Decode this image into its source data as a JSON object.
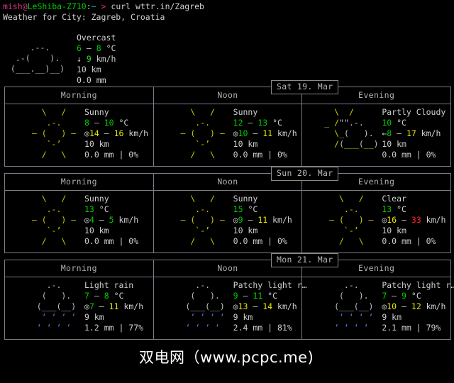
{
  "terminal": {
    "prompt": {
      "user_host": "mish@LeShiba-Z710",
      "user": "mish@",
      "host": "LeShiba-Z710",
      "colon": ":",
      "path": "~",
      "symbol": ">",
      "command": "curl wttr.in/Zagreb"
    },
    "subtitle": "Weather for City: Zagreb, Croatia"
  },
  "current": {
    "art": [
      "     .--.    ",
      "  .-(    ).  ",
      " (___.__)__) "
    ],
    "condition": "Overcast",
    "temperature": "6 – 8 °C",
    "temp_low": "6",
    "temp_dash": " – ",
    "temp_high": "8",
    "temp_unit": " °C",
    "wind_icon": "↓",
    "wind_value": "9",
    "wind_unit": " km/h",
    "visibility": "10 km",
    "precipitation": "0.0 mm"
  },
  "columns": [
    "Morning",
    "Noon",
    "Evening"
  ],
  "days": [
    {
      "label": "Sat 19. Mar",
      "slots": [
        {
          "period": "Morning",
          "icon": "sun",
          "art": [
            "    \\   /    ",
            "     .-.     ",
            "  ― (   ) ―  ",
            "     `-’     ",
            "    /   \\    "
          ],
          "condition": "Sunny",
          "temp_low": "8",
          "temp_dash": " – ",
          "temp_high": "10",
          "temp_unit": " °C",
          "temp_low_color": "green",
          "temp_high_color": "green",
          "wind_icon": "◎",
          "wind_low": "14",
          "wind_dash": " – ",
          "wind_high": "16",
          "wind_unit": " km/h",
          "wind_low_color": "yellow",
          "wind_high_color": "yellow",
          "visibility": "10 km",
          "precip": "0.0 mm | 0%"
        },
        {
          "period": "Noon",
          "icon": "sun",
          "art": [
            "    \\   /    ",
            "     .-.     ",
            "  ― (   ) ―  ",
            "     `-’     ",
            "    /   \\    "
          ],
          "condition": "Sunny",
          "temp_low": "12",
          "temp_dash": " – ",
          "temp_high": "13",
          "temp_unit": " °C",
          "temp_low_color": "green",
          "temp_high_color": "green",
          "wind_icon": "◎",
          "wind_low": "10",
          "wind_dash": " – ",
          "wind_high": "11",
          "wind_unit": " km/h",
          "wind_low_color": "green",
          "wind_high_color": "yellow",
          "visibility": "10 km",
          "precip": "0.0 mm | 0%"
        },
        {
          "period": "Evening",
          "icon": "partly-cloudy",
          "art": [
            "   \\  /      ",
            " _ /\"\".-.    ",
            "   \\_(   ).  ",
            "   /(___(__) ",
            "             "
          ],
          "condition": "Partly Cloudy",
          "temp_low": "10",
          "temp_dash": "",
          "temp_high": "",
          "temp_unit": " °C",
          "temp_low_color": "green",
          "temp_high_color": "green",
          "wind_icon": "←",
          "wind_low": "8",
          "wind_dash": " – ",
          "wind_high": "17",
          "wind_unit": " km/h",
          "wind_low_color": "green",
          "wind_high_color": "yellow",
          "visibility": "10 km",
          "precip": "0.0 mm | 0%"
        }
      ]
    },
    {
      "label": "Sun 20. Mar",
      "slots": [
        {
          "period": "Morning",
          "icon": "sun",
          "art": [
            "    \\   /    ",
            "     .-.     ",
            "  ― (   ) ―  ",
            "     `-’     ",
            "    /   \\    "
          ],
          "condition": "Sunny",
          "temp_low": "13",
          "temp_dash": "",
          "temp_high": "",
          "temp_unit": " °C",
          "temp_low_color": "green",
          "temp_high_color": "green",
          "wind_icon": "◎",
          "wind_low": "4",
          "wind_dash": " – ",
          "wind_high": "5",
          "wind_unit": " km/h",
          "wind_low_color": "green",
          "wind_high_color": "green",
          "visibility": "10 km",
          "precip": "0.0 mm | 0%"
        },
        {
          "period": "Noon",
          "icon": "sun",
          "art": [
            "    \\   /    ",
            "     .-.     ",
            "  ― (   ) ―  ",
            "     `-’     ",
            "    /   \\    "
          ],
          "condition": "Sunny",
          "temp_low": "15",
          "temp_dash": "",
          "temp_high": "",
          "temp_unit": " °C",
          "temp_low_color": "green",
          "temp_high_color": "green",
          "wind_icon": "◎",
          "wind_low": "9",
          "wind_dash": " – ",
          "wind_high": "11",
          "wind_unit": " km/h",
          "wind_low_color": "green",
          "wind_high_color": "yellow",
          "visibility": "10 km",
          "precip": "0.0 mm | 0%"
        },
        {
          "period": "Evening",
          "icon": "sun",
          "art": [
            "    \\   /    ",
            "     .-.     ",
            "  ― (   ) ―  ",
            "     `-’     ",
            "    /   \\    "
          ],
          "condition": "Clear",
          "temp_low": "13",
          "temp_dash": "",
          "temp_high": "",
          "temp_unit": " °C",
          "temp_low_color": "green",
          "temp_high_color": "green",
          "wind_icon": "◎",
          "wind_low": "16",
          "wind_dash": " – ",
          "wind_high": "33",
          "wind_unit": " km/h",
          "wind_low_color": "yellow",
          "wind_high_color": "red",
          "visibility": "10 km",
          "precip": "0.0 mm | 0%"
        }
      ]
    },
    {
      "label": "Mon 21. Mar",
      "slots": [
        {
          "period": "Morning",
          "icon": "light-rain",
          "art": [
            "     .-.     ",
            "    (   ).   ",
            "   (___(__)  ",
            "    ‘ ‘ ‘ ‘  ",
            "   ‘ ‘ ‘ ‘   "
          ],
          "condition": "Light rain",
          "temp_low": "7",
          "temp_dash": " – ",
          "temp_high": "8",
          "temp_unit": " °C",
          "temp_low_color": "green",
          "temp_high_color": "green",
          "wind_icon": "◎",
          "wind_low": "7",
          "wind_dash": " – ",
          "wind_high": "11",
          "wind_unit": " km/h",
          "wind_low_color": "green",
          "wind_high_color": "yellow",
          "visibility": "9 km",
          "precip": "1.2 mm | 77%"
        },
        {
          "period": "Noon",
          "icon": "light-rain",
          "art": [
            "     .-.     ",
            "    (   ).   ",
            "   (___(__)  ",
            "    ‘ ‘ ‘ ‘  ",
            "   ‘ ‘ ‘ ‘   "
          ],
          "condition": "Patchy light r…",
          "temp_low": "9",
          "temp_dash": " – ",
          "temp_high": "11",
          "temp_unit": " °C",
          "temp_low_color": "green",
          "temp_high_color": "green",
          "wind_icon": "◎",
          "wind_low": "13",
          "wind_dash": " – ",
          "wind_high": "14",
          "wind_unit": " km/h",
          "wind_low_color": "yellow",
          "wind_high_color": "yellow",
          "visibility": "9 km",
          "precip": "2.4 mm | 81%"
        },
        {
          "period": "Evening",
          "icon": "light-rain",
          "art": [
            "     .-.     ",
            "    (   ).   ",
            "   (___(__)  ",
            "    ‘ ‘ ‘ ‘  ",
            "   ‘ ‘ ‘ ‘   "
          ],
          "condition": "Patchy light r…",
          "temp_low": "7",
          "temp_dash": " – ",
          "temp_high": "9",
          "temp_unit": " °C",
          "temp_low_color": "green",
          "temp_high_color": "green",
          "wind_icon": "◎",
          "wind_low": "10",
          "wind_dash": " – ",
          "wind_high": "12",
          "wind_unit": " km/h",
          "wind_low_color": "yellow",
          "wind_high_color": "yellow",
          "visibility": "9 km",
          "precip": "2.1 mm | 79%"
        }
      ]
    }
  ],
  "watermark": "双电网（www.pcpc.me)",
  "colors": {
    "background": "#000000",
    "foreground": "#c8c8c8",
    "green": "#00cc00",
    "yellow": "#cdcd00",
    "red": "#cd0000",
    "magenta": "#d33682",
    "cyan": "#00cdcd",
    "border": "#7c7c88"
  }
}
